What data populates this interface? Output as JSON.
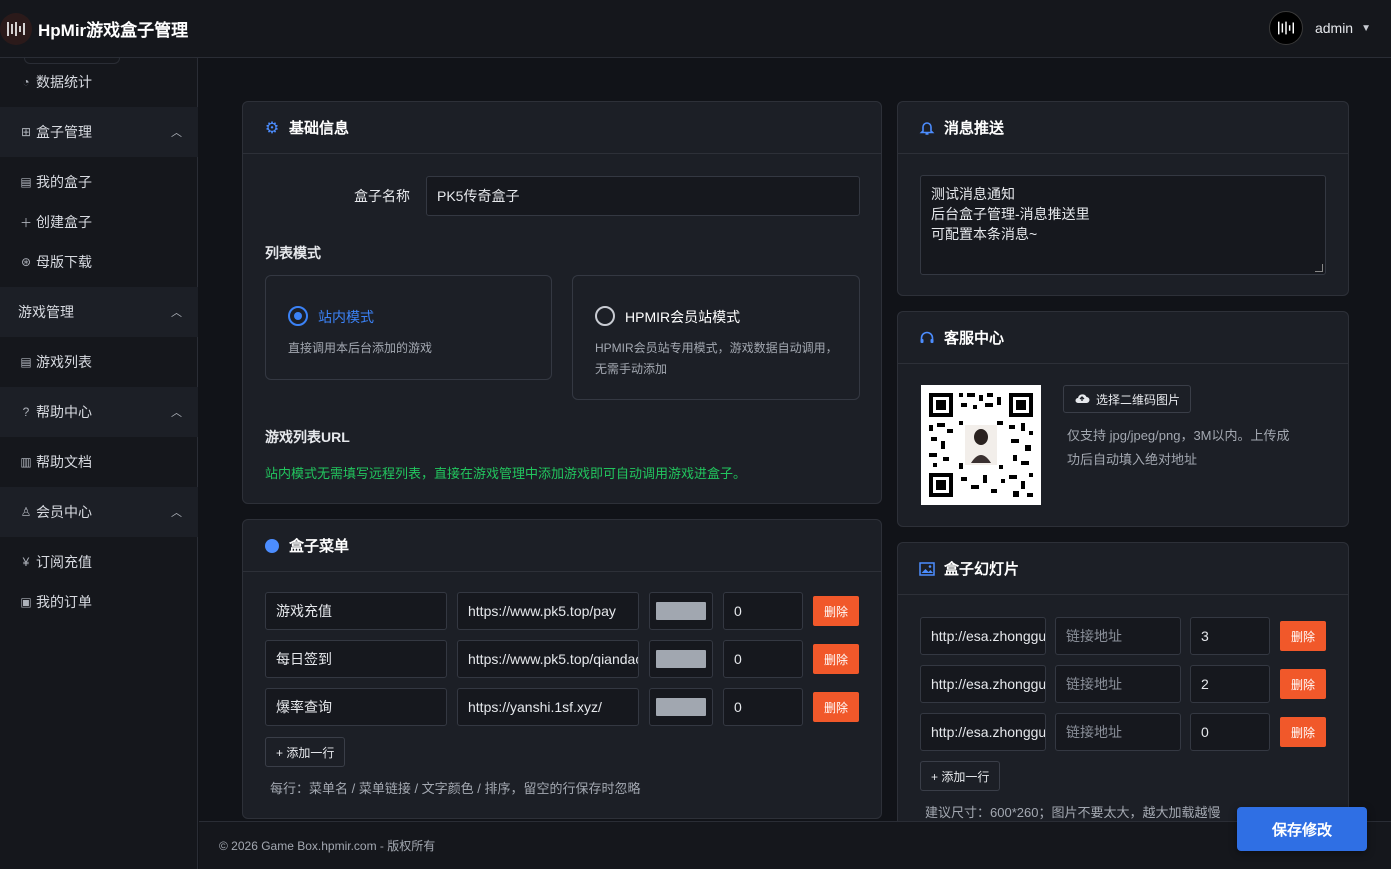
{
  "app": {
    "title": "HpMir游戏盒子管理",
    "user": "admin"
  },
  "sidebar": {
    "items": [
      {
        "label": "数据统计",
        "icon": "dashboard-icon"
      },
      {
        "label": "盒子管理",
        "icon": "apps-icon",
        "group": true
      },
      {
        "label": "我的盒子",
        "icon": "document-icon"
      },
      {
        "label": "创建盒子",
        "icon": "plus-icon"
      },
      {
        "label": "母版下载",
        "icon": "download-icon"
      },
      {
        "label": "游戏管理",
        "group": true
      },
      {
        "label": "游戏列表",
        "icon": "document-icon"
      },
      {
        "label": "帮助中心",
        "icon": "question-icon",
        "group": true
      },
      {
        "label": "帮助文档",
        "icon": "book-icon"
      },
      {
        "label": "会员中心",
        "icon": "user-icon",
        "group": true
      },
      {
        "label": "订阅充值",
        "icon": "yen-icon"
      },
      {
        "label": "我的订单",
        "icon": "order-icon"
      }
    ]
  },
  "basic": {
    "title": "基础信息",
    "name_label": "盒子名称",
    "name_value": "PK5传奇盒子",
    "list_mode_label": "列表模式",
    "mode_site": {
      "title": "站内模式",
      "desc": "直接调用本后台添加的游戏",
      "selected": true
    },
    "mode_member": {
      "title": "HPMIR会员站模式",
      "desc1": "HPMIR会员站专用模式，游戏数据自动调用，",
      "desc2": "无需手动添加",
      "selected": false
    },
    "url_label": "游戏列表URL",
    "url_hint": "站内模式无需填写远程列表，直接在游戏管理中添加游戏即可自动调用游戏进盒子。"
  },
  "menu": {
    "title": "盒子菜单",
    "rows": [
      {
        "name": "游戏充值",
        "link": "https://www.pk5.top/pay",
        "color": "#a1a7b0",
        "order": "0"
      },
      {
        "name": "每日签到",
        "link": "https://www.pk5.top/qiandao",
        "color": "#a1a7b0",
        "order": "0"
      },
      {
        "name": "爆率查询",
        "link": "https://yanshi.1sf.xyz/",
        "color": "#a1a7b0",
        "order": "0"
      }
    ],
    "delete_label": "删除",
    "add_label": "+ 添加一行",
    "hint": "每行：菜单名 / 菜单链接 / 文字颜色 / 排序，留空的行保存时忽略"
  },
  "push": {
    "title": "消息推送",
    "lines": [
      "测试消息通知",
      "后台盒子管理-消息推送里",
      "可配置本条消息~"
    ]
  },
  "service": {
    "title": "客服中心",
    "upload_label": "选择二维码图片",
    "hint1": "仅支持 jpg/jpeg/png，3M以内。上传成",
    "hint2": "功后自动填入绝对地址"
  },
  "slides": {
    "title": "盒子幻灯片",
    "rows": [
      {
        "image": "http://esa.zhonggu",
        "link_placeholder": "链接地址",
        "order": "3"
      },
      {
        "image": "http://esa.zhonggu",
        "link_placeholder": "链接地址",
        "order": "2"
      },
      {
        "image": "http://esa.zhonggu",
        "link_placeholder": "链接地址",
        "order": "0"
      }
    ],
    "delete_label": "删除",
    "add_label": "+ 添加一行",
    "hint": "建议尺寸：600*260；图片不要太大，越大加载越慢"
  },
  "footer": {
    "text": "© 2026 Game Box.hpmir.com - 版权所有"
  },
  "save_label": "保存修改",
  "colors": {
    "accent": "#3b82f6",
    "danger": "#f1582a",
    "success": "#22c55e"
  }
}
